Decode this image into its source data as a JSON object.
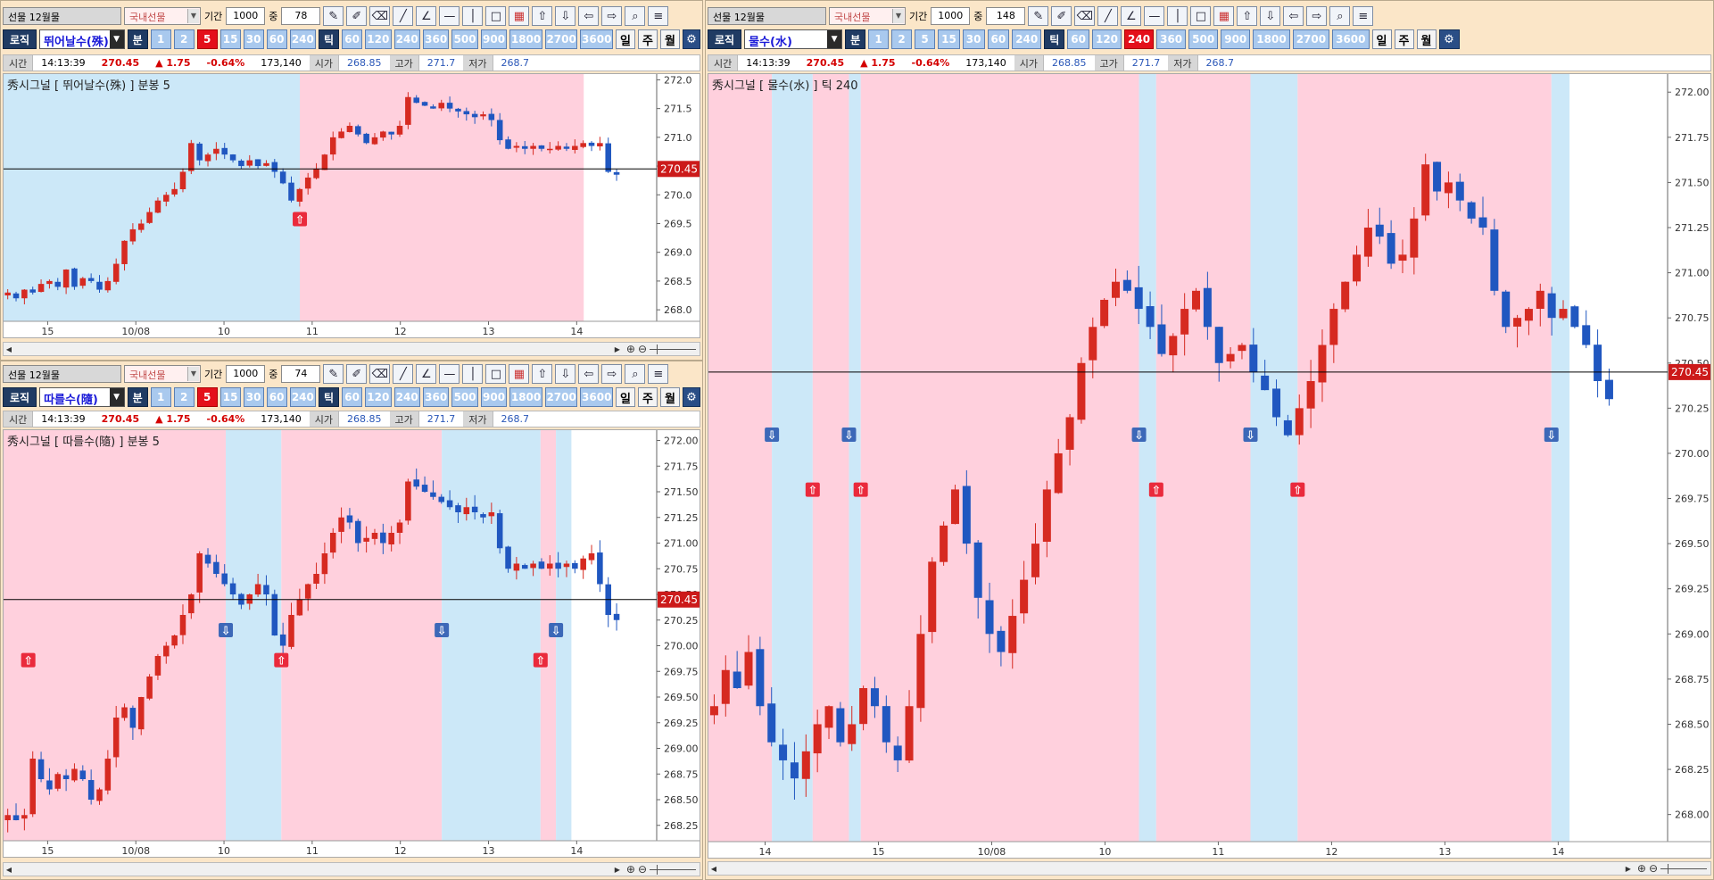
{
  "toolbar": {
    "market_label": "선물 12월물",
    "domestic_label": "국내선물",
    "period_label": "기간",
    "count_label": "중",
    "logic_button": "로직",
    "minute_label": "분",
    "tick_label": "틱",
    "day_label": "일",
    "week_label": "주",
    "month_label": "월",
    "minute_periods": [
      "1",
      "2",
      "5",
      "15",
      "30",
      "60",
      "240"
    ],
    "tick_periods": [
      "60",
      "120",
      "240",
      "360",
      "500",
      "900",
      "1800",
      "2700",
      "3600"
    ]
  },
  "quote": {
    "time_label": "시간",
    "time": "14:13:39",
    "price": "270.45",
    "change": "▲ 1.75",
    "change_pct": "-0.64%",
    "volume": "173,140",
    "open_label": "시가",
    "open": "268.85",
    "high_label": "고가",
    "high": "271.7",
    "low_label": "저가",
    "low": "268.7"
  },
  "panels": {
    "top_left": {
      "period": "1000",
      "count": "78",
      "strategy": "뛰어날수(殊)",
      "selected_minute": "5",
      "selected_tick": "",
      "chart_title": "秀시그널 [ 뛰어날수(殊) ] 분봉 5",
      "current_price": "270.45",
      "y_ticks": [
        "272.0",
        "271.5",
        "271.0",
        "270.5",
        "270.0",
        "269.5",
        "269.0",
        "268.5",
        "268.0"
      ],
      "x_labels": [
        "15",
        "10/08",
        "10",
        "11",
        "12",
        "13",
        "14"
      ]
    },
    "bottom_left": {
      "period": "1000",
      "count": "74",
      "strategy": "따를수(隨)",
      "selected_minute": "5",
      "selected_tick": "",
      "chart_title": "秀시그널 [ 따를수(隨) ] 분봉 5",
      "current_price": "270.45",
      "y_ticks": [
        "272.00",
        "271.75",
        "271.50",
        "271.25",
        "271.00",
        "270.75",
        "270.50",
        "270.25",
        "270.00",
        "269.75",
        "269.50",
        "269.25",
        "269.00",
        "268.75",
        "268.50",
        "268.25"
      ],
      "x_labels": [
        "15",
        "10/08",
        "10",
        "11",
        "12",
        "13",
        "14"
      ]
    },
    "right": {
      "period": "1000",
      "count": "148",
      "strategy": "물수(水)",
      "selected_minute": "",
      "selected_tick": "240",
      "chart_title": "秀시그널 [ 물수(水) ] 틱 240",
      "current_price": "270.45",
      "y_ticks": [
        "272.00",
        "271.75",
        "271.50",
        "271.25",
        "271.00",
        "270.75",
        "270.50",
        "270.25",
        "270.00",
        "269.75",
        "269.50",
        "269.25",
        "269.00",
        "268.75",
        "268.50",
        "268.25",
        "268.00"
      ],
      "x_labels": [
        "14",
        "15",
        "10/08",
        "10",
        "11",
        "12",
        "13",
        "14"
      ]
    }
  },
  "colors": {
    "up": "#d62a21",
    "down": "#2057c0",
    "buy_zone": "#ffd0dd",
    "sell_zone": "#cce8f8",
    "price_line": "#000000",
    "price_tag": "#cc1a1a",
    "signal_buy": "#ea2a3c",
    "signal_sell": "#3c68b8"
  },
  "icons": [
    "pencil-icon",
    "edit-icon",
    "eraser-icon",
    "line-icon",
    "angle-line-icon",
    "horizontal-line-icon",
    "vertical-line-icon",
    "rectangle-icon",
    "palette-icon",
    "arrow-up-icon",
    "arrow-down-icon",
    "arrow-left-icon",
    "arrow-right-icon",
    "zoom-fit-icon",
    "menu-icon",
    "gear-icon",
    "zoom-in-icon",
    "zoom-out-icon"
  ],
  "chart_data": [
    {
      "type": "candlestick",
      "title": "秀시그널 [ 뛰어날수(殊) ] 분봉 5",
      "ylim": [
        267.8,
        272.1
      ],
      "x_labels": [
        "15",
        "10/08",
        "10",
        "11",
        "12",
        "13",
        "14"
      ],
      "current_price": 270.45,
      "zones": [
        {
          "side": "sell",
          "from": 0,
          "to": 0.48
        },
        {
          "side": "buy",
          "from": 0.48,
          "to": 0.94
        }
      ],
      "signals": [
        {
          "type": "buy",
          "at": 0.48
        }
      ],
      "path": [
        268.3,
        268.2,
        268.35,
        268.3,
        268.45,
        268.5,
        268.4,
        268.7,
        268.4,
        268.55,
        268.5,
        268.35,
        268.5,
        268.8,
        269.2,
        269.4,
        269.5,
        269.7,
        269.9,
        270.0,
        270.1,
        270.4,
        270.9,
        270.6,
        270.7,
        270.8,
        270.7,
        270.6,
        270.5,
        270.6,
        270.5,
        270.55,
        270.4,
        270.2,
        269.9,
        270.1,
        270.3,
        270.45,
        270.7,
        271.0,
        271.1,
        271.2,
        271.05,
        270.9,
        271.0,
        271.1,
        271.05,
        271.2,
        271.7,
        271.6,
        271.55,
        271.5,
        271.6,
        271.5,
        271.45,
        271.4,
        271.35,
        271.4,
        271.3,
        270.95,
        270.8,
        270.85,
        270.8,
        270.85,
        270.8,
        270.8,
        270.85,
        270.8,
        270.85,
        270.9,
        270.85,
        270.9,
        270.4,
        270.35
      ]
    },
    {
      "type": "candlestick",
      "title": "秀시그널 [ 따를수(隨) ] 분봉 5",
      "ylim": [
        268.1,
        272.1
      ],
      "x_labels": [
        "15",
        "10/08",
        "10",
        "11",
        "12",
        "13",
        "14"
      ],
      "current_price": 270.45,
      "zones": [
        {
          "side": "buy",
          "from": 0,
          "to": 0.36
        },
        {
          "side": "sell",
          "from": 0.36,
          "to": 0.45
        },
        {
          "side": "buy",
          "from": 0.45,
          "to": 0.71
        },
        {
          "side": "sell",
          "from": 0.71,
          "to": 0.87
        },
        {
          "side": "buy",
          "from": 0.87,
          "to": 0.895
        },
        {
          "side": "sell",
          "from": 0.895,
          "to": 0.92
        }
      ],
      "signals": [
        {
          "type": "buy",
          "at": 0.04
        },
        {
          "type": "sell",
          "at": 0.36
        },
        {
          "type": "buy",
          "at": 0.45
        },
        {
          "type": "sell",
          "at": 0.71
        },
        {
          "type": "buy",
          "at": 0.87
        },
        {
          "type": "sell",
          "at": 0.895
        }
      ],
      "path": [
        268.35,
        268.3,
        268.35,
        268.9,
        268.7,
        268.6,
        268.75,
        268.7,
        268.8,
        268.7,
        268.5,
        268.6,
        268.9,
        269.3,
        269.4,
        269.2,
        269.5,
        269.7,
        269.9,
        270.0,
        270.1,
        270.3,
        270.5,
        270.9,
        270.8,
        270.7,
        270.6,
        270.5,
        270.4,
        270.5,
        270.6,
        270.5,
        270.1,
        270.0,
        270.3,
        270.45,
        270.6,
        270.7,
        270.9,
        271.1,
        271.25,
        271.2,
        271.0,
        271.05,
        271.1,
        271.0,
        271.1,
        271.2,
        271.6,
        271.55,
        271.5,
        271.45,
        271.4,
        271.35,
        271.3,
        271.35,
        271.3,
        271.25,
        271.3,
        270.95,
        270.75,
        270.8,
        270.75,
        270.8,
        270.75,
        270.8,
        270.75,
        270.8,
        270.75,
        270.85,
        270.9,
        270.6,
        270.3,
        270.25
      ]
    },
    {
      "type": "candlestick",
      "title": "秀시그널 [ 물수(水) ] 틱 240",
      "ylim": [
        267.85,
        272.1
      ],
      "x_labels": [
        "14",
        "15",
        "10/08",
        "10",
        "11",
        "12",
        "13",
        "14"
      ],
      "current_price": 270.45,
      "zones": [
        {
          "side": "buy",
          "from": 0,
          "to": 0.07
        },
        {
          "side": "sell",
          "from": 0.07,
          "to": 0.115
        },
        {
          "side": "buy",
          "from": 0.115,
          "to": 0.155
        },
        {
          "side": "sell",
          "from": 0.155,
          "to": 0.168
        },
        {
          "side": "buy",
          "from": 0.168,
          "to": 0.475
        },
        {
          "side": "sell",
          "from": 0.475,
          "to": 0.494
        },
        {
          "side": "buy",
          "from": 0.494,
          "to": 0.598
        },
        {
          "side": "sell",
          "from": 0.598,
          "to": 0.65
        },
        {
          "side": "buy",
          "from": 0.65,
          "to": 0.93
        },
        {
          "side": "sell",
          "from": 0.93,
          "to": 0.95
        }
      ],
      "signals": [
        {
          "type": "sell",
          "at": 0.07
        },
        {
          "type": "buy",
          "at": 0.115
        },
        {
          "type": "sell",
          "at": 0.155
        },
        {
          "type": "buy",
          "at": 0.168
        },
        {
          "type": "sell",
          "at": 0.475
        },
        {
          "type": "buy",
          "at": 0.494
        },
        {
          "type": "sell",
          "at": 0.598
        },
        {
          "type": "buy",
          "at": 0.65
        },
        {
          "type": "sell",
          "at": 0.93
        }
      ],
      "path": [
        268.6,
        268.8,
        268.7,
        268.9,
        268.6,
        268.4,
        268.3,
        268.2,
        268.35,
        268.5,
        268.6,
        268.4,
        268.5,
        268.7,
        268.6,
        268.4,
        268.3,
        268.6,
        269.0,
        269.4,
        269.6,
        269.8,
        269.5,
        269.2,
        269.0,
        268.9,
        269.1,
        269.3,
        269.5,
        269.8,
        270.0,
        270.2,
        270.5,
        270.7,
        270.85,
        270.95,
        270.9,
        270.8,
        270.7,
        270.55,
        270.65,
        270.8,
        270.9,
        270.7,
        270.5,
        270.55,
        270.6,
        270.45,
        270.35,
        270.2,
        270.1,
        270.25,
        270.4,
        270.6,
        270.8,
        270.95,
        271.1,
        271.25,
        271.2,
        271.05,
        271.1,
        271.3,
        271.6,
        271.45,
        271.5,
        271.4,
        271.3,
        271.25,
        270.9,
        270.7,
        270.75,
        270.8,
        270.9,
        270.75,
        270.8,
        270.7,
        270.6,
        270.4,
        270.3
      ]
    }
  ]
}
